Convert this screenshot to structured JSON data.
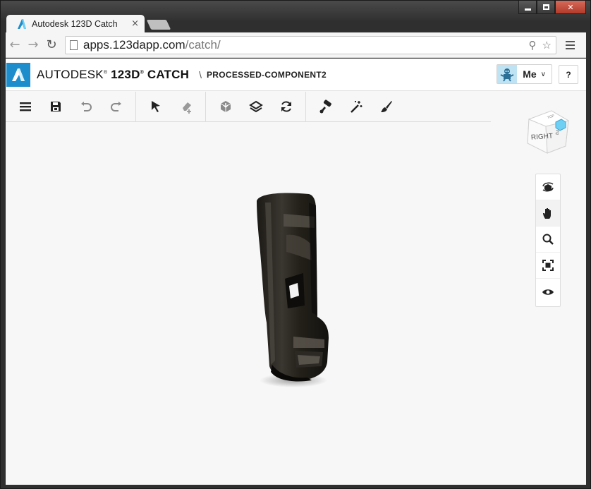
{
  "browser": {
    "tab": {
      "title": "Autodesk 123D Catch",
      "close": "×"
    },
    "address": {
      "domain": "apps.123dapp.com",
      "path": "/catch/"
    }
  },
  "app": {
    "brand_prefix": "AUTODESK",
    "brand_product": "123D",
    "brand_suffix": "CATCH",
    "separator": "\\",
    "document_name": "PROCESSED-COMPONENT2",
    "user_label": "Me",
    "help_label": "?"
  },
  "toolbar": {
    "groups": [
      [
        "menu-icon",
        "save-icon",
        "undo-icon",
        "redo-icon"
      ],
      [
        "select-icon",
        "eraser-add-icon"
      ],
      [
        "solid-icon",
        "layers-icon",
        "refresh-icon"
      ],
      [
        "paint-roller-icon",
        "magic-wand-icon",
        "brush-icon"
      ]
    ]
  },
  "viewcube": {
    "label": "RIGHT",
    "accent": "#6fd0f3"
  },
  "navbar": {
    "items": [
      "orbit-icon",
      "pan-icon",
      "zoom-icon",
      "fit-view-icon",
      "visibility-icon"
    ],
    "active": "pan-icon"
  },
  "colors": {
    "brand": "#1d8ecb",
    "avatar_bg": "#bfe3f3"
  }
}
